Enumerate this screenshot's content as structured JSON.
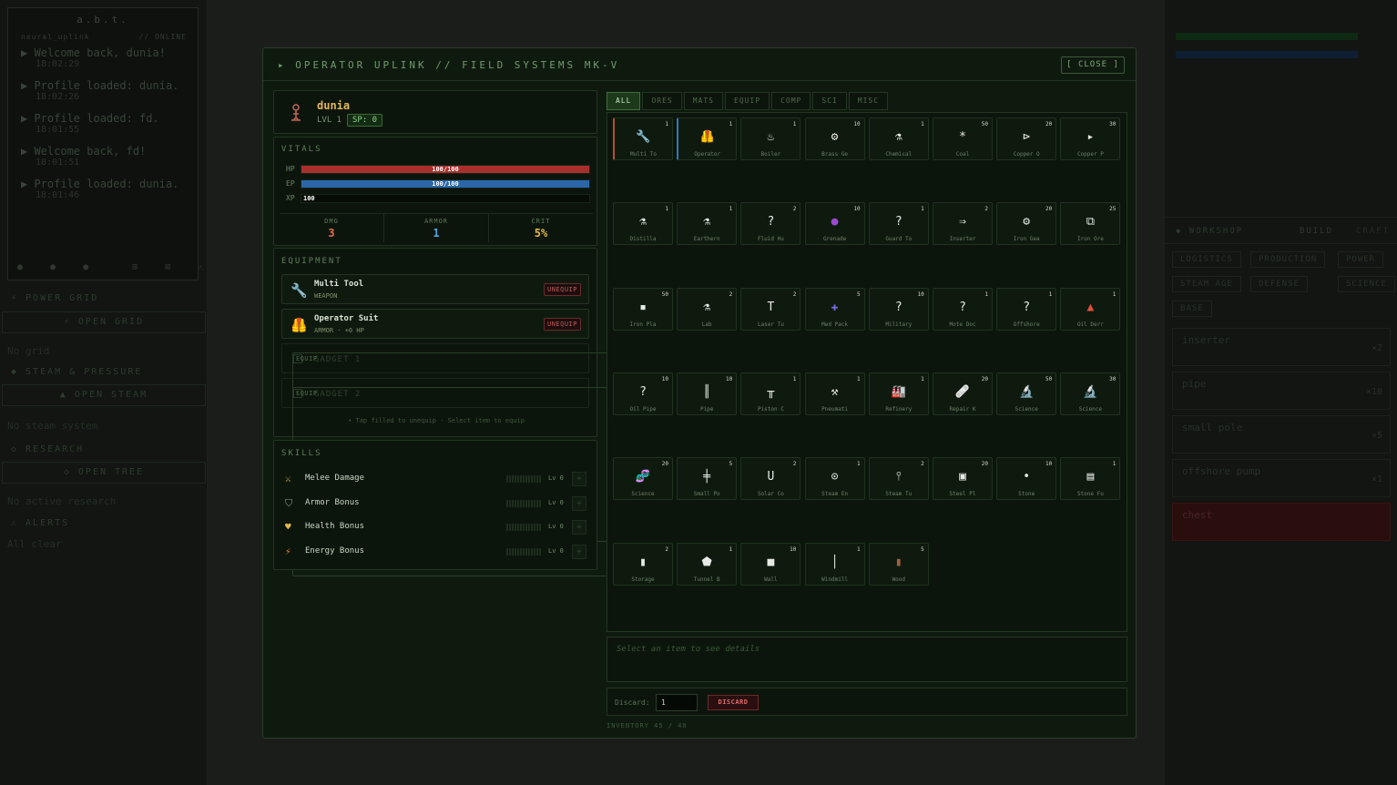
{
  "background": {
    "terminal": {
      "title": "a.b.t.",
      "sub_left": "neural_uplink",
      "sub_right": "// ONLINE",
      "logs": [
        {
          "msg": "Welcome back, dunia!",
          "time": "18:02:29"
        },
        {
          "msg": "Profile loaded: dunia.",
          "time": "18:02:26"
        },
        {
          "msg": "Profile loaded: fd.",
          "time": "18:01:55"
        },
        {
          "msg": "Welcome back, fd!",
          "time": "18:01:51"
        },
        {
          "msg": "Profile loaded: dunia.",
          "time": "18:01:46"
        }
      ]
    },
    "left_sections": {
      "power": "⚡ POWER GRID",
      "power_btn": "⚡ OPEN GRID",
      "power_note": "No grid",
      "steam": "◆ STEAM & PRESSURE",
      "steam_btn": "▲ OPEN STEAM",
      "steam_note": "No steam system",
      "research": "◇ RESEARCH",
      "research_btn": "◇ OPEN TREE",
      "research_note": "No active research",
      "alerts": "⚠ ALERTS",
      "alerts_note": "All clear"
    },
    "right": {
      "workshop": "◆ WORKSHOP",
      "build": "BUILD",
      "craft": "CRAFT",
      "tabs": [
        "LOGISTICS",
        "PRODUCTION",
        "POWER",
        "STEAM AGE",
        "DEFENSE",
        "SCIENCE",
        "BASE"
      ],
      "rows": [
        {
          "name": "inserter",
          "val": "×2"
        },
        {
          "name": "pipe",
          "val": "×10"
        },
        {
          "name": "small pole",
          "val": "×5"
        },
        {
          "name": "offshore pump",
          "val": "×1"
        },
        {
          "name": "chest",
          "val": ""
        }
      ]
    }
  },
  "modal": {
    "title": "▸ OPERATOR UPLINK // FIELD SYSTEMS MK-V",
    "close": "[ CLOSE ]",
    "profile": {
      "name": "dunia",
      "level": "LVL 1",
      "sp": "SP: 0"
    },
    "vitals": {
      "label": "VITALS",
      "hp": {
        "label": "HP",
        "text": "100/100",
        "value": 1.0,
        "color": "#a8302c"
      },
      "ep": {
        "label": "EP",
        "text": "100/100",
        "value": 1.0,
        "color": "#2b67a8"
      },
      "xp": {
        "label": "XP",
        "text": "100",
        "value": 0.0,
        "color": "#3a5a38"
      },
      "stats": [
        {
          "label": "DMG",
          "value": "3",
          "color": "#e0704a"
        },
        {
          "label": "ARMOR",
          "value": "1",
          "color": "#5aa3e0"
        },
        {
          "label": "CRIT",
          "value": "5%",
          "color": "#e6b84a"
        }
      ]
    },
    "equipment": {
      "label": "EQUIPMENT",
      "slots": [
        {
          "name": "Multi Tool",
          "sub": "WEAPON",
          "icon": "wrench-icon",
          "button": "UNEQUIP"
        },
        {
          "name": "Operator Suit",
          "sub": "ARMOR · +0 HP",
          "icon": "suit-icon",
          "button": "UNEQUIP"
        },
        {
          "name": "GADGET 1",
          "sub": "",
          "icon": "",
          "button": "EQUIP"
        },
        {
          "name": "GADGET 2",
          "sub": "",
          "icon": "",
          "button": "EQUIP"
        }
      ],
      "hint": "• Tap filled to unequip · Select item to equip"
    },
    "skills": {
      "label": "SKILLS",
      "items": [
        {
          "name": "Melee Damage",
          "level": "Lv 0",
          "icon": "swords-icon",
          "color": "#c8a050"
        },
        {
          "name": "Armor Bonus",
          "level": "Lv 0",
          "icon": "shield-icon",
          "color": "#8c9c88"
        },
        {
          "name": "Health Bonus",
          "level": "Lv 0",
          "icon": "heart-icon",
          "color": "#e6b84a"
        },
        {
          "name": "Energy Bonus",
          "level": "Lv 0",
          "icon": "bolt-icon",
          "color": "#e67a2a"
        }
      ],
      "plus": "+"
    },
    "tabs": [
      "ALL",
      "ORES",
      "MATS",
      "EQUIP",
      "COMP",
      "SCI",
      "MISC"
    ],
    "items": [
      {
        "name": "Multi To",
        "qty": "1",
        "glyph": "🔧",
        "color": "#dfe3dc",
        "sel": "o"
      },
      {
        "name": "Operator",
        "qty": "1",
        "glyph": "🦺",
        "color": "#e6a84a",
        "sel": "b"
      },
      {
        "name": "Boiler",
        "qty": "1",
        "glyph": "♨",
        "color": "#e6e9e4"
      },
      {
        "name": "Brass Ge",
        "qty": "10",
        "glyph": "⚙",
        "color": "#e6e9e4"
      },
      {
        "name": "Chemical",
        "qty": "1",
        "glyph": "⚗",
        "color": "#e6e9e4"
      },
      {
        "name": "Coal",
        "qty": "50",
        "glyph": "*",
        "color": "#e6e9e4"
      },
      {
        "name": "Copper O",
        "qty": "20",
        "glyph": "⊳",
        "color": "#e6e9e4"
      },
      {
        "name": "Copper P",
        "qty": "30",
        "glyph": "▸",
        "color": "#e6e9e4"
      },
      {
        "name": "Distilla",
        "qty": "1",
        "glyph": "⚗",
        "color": "#e6e9e4"
      },
      {
        "name": "Earthern",
        "qty": "1",
        "glyph": "⚗",
        "color": "#e6e9e4"
      },
      {
        "name": "Fluid Hu",
        "qty": "2",
        "glyph": "?",
        "color": "#e6e9e4"
      },
      {
        "name": "Grenade",
        "qty": "10",
        "glyph": "●",
        "color": "#9a4ad0"
      },
      {
        "name": "Guard To",
        "qty": "1",
        "glyph": "?",
        "color": "#e6e9e4"
      },
      {
        "name": "Inserter",
        "qty": "2",
        "glyph": "⇒",
        "color": "#e6e9e4"
      },
      {
        "name": "Iron Gea",
        "qty": "20",
        "glyph": "⚙",
        "color": "#e6e9e4"
      },
      {
        "name": "Iron Ore",
        "qty": "25",
        "glyph": "⧉",
        "color": "#e6e9e4"
      },
      {
        "name": "Iron Pla",
        "qty": "50",
        "glyph": "▪",
        "color": "#e6e9e4"
      },
      {
        "name": "Lab",
        "qty": "2",
        "glyph": "⚗",
        "color": "#e6e9e4"
      },
      {
        "name": "Laser Tu",
        "qty": "2",
        "glyph": "T",
        "color": "#e6e9e4"
      },
      {
        "name": "Med Pack",
        "qty": "5",
        "glyph": "✚",
        "color": "#7a6ae0"
      },
      {
        "name": "Military",
        "qty": "10",
        "glyph": "?",
        "color": "#e6e9e4"
      },
      {
        "name": "Mote Doc",
        "qty": "1",
        "glyph": "?",
        "color": "#e6e9e4"
      },
      {
        "name": "Offshore",
        "qty": "1",
        "glyph": "?",
        "color": "#e6e9e4"
      },
      {
        "name": "Oil Derr",
        "qty": "1",
        "glyph": "▲",
        "color": "#e0503a"
      },
      {
        "name": "Oil Pipe",
        "qty": "10",
        "glyph": "?",
        "color": "#e6e9e4"
      },
      {
        "name": "Pipe",
        "qty": "10",
        "glyph": "║",
        "color": "#e6e9e4"
      },
      {
        "name": "Piston C",
        "qty": "1",
        "glyph": "╥",
        "color": "#e6e9e4"
      },
      {
        "name": "Pneumati",
        "qty": "1",
        "glyph": "⚒",
        "color": "#e6e9e4"
      },
      {
        "name": "Refinery",
        "qty": "1",
        "glyph": "🏭",
        "color": "#6a7ae0"
      },
      {
        "name": "Repair K",
        "qty": "20",
        "glyph": "🩹",
        "color": "#5aa3e0"
      },
      {
        "name": "Science",
        "qty": "50",
        "glyph": "🔬",
        "color": "#8ab0e0"
      },
      {
        "name": "Science",
        "qty": "30",
        "glyph": "🔬",
        "color": "#8ab0e0"
      },
      {
        "name": "Science",
        "qty": "20",
        "glyph": "🧬",
        "color": "#c04a8a"
      },
      {
        "name": "Small Po",
        "qty": "5",
        "glyph": "╪",
        "color": "#e6e9e4"
      },
      {
        "name": "Solar Co",
        "qty": "2",
        "glyph": "U",
        "color": "#e6e9e4"
      },
      {
        "name": "Steam En",
        "qty": "1",
        "glyph": "⊙",
        "color": "#e6e9e4"
      },
      {
        "name": "Steam Tu",
        "qty": "2",
        "glyph": "⫯",
        "color": "#e6e9e4"
      },
      {
        "name": "Steel Pl",
        "qty": "20",
        "glyph": "▣",
        "color": "#e6e9e4"
      },
      {
        "name": "Stone",
        "qty": "10",
        "glyph": "•",
        "color": "#e6e9e4"
      },
      {
        "name": "Stone Fu",
        "qty": "1",
        "glyph": "▤",
        "color": "#e6e9e4"
      },
      {
        "name": "Storage",
        "qty": "2",
        "glyph": "▮",
        "color": "#e6e9e4"
      },
      {
        "name": "Tunnel B",
        "qty": "1",
        "glyph": "⬟",
        "color": "#e6e9e4"
      },
      {
        "name": "Wall",
        "qty": "10",
        "glyph": "■",
        "color": "#e6e9e4"
      },
      {
        "name": "Windmill",
        "qty": "1",
        "glyph": "│",
        "color": "#e6e9e4"
      },
      {
        "name": "Wood",
        "qty": "5",
        "glyph": "▮",
        "color": "#a0603a"
      }
    ],
    "details_placeholder": "Select an item to see details",
    "discard": {
      "label": "Discard:",
      "value": "1",
      "button": "DISCARD"
    },
    "inventory_count": "INVENTORY 45 / 40"
  }
}
